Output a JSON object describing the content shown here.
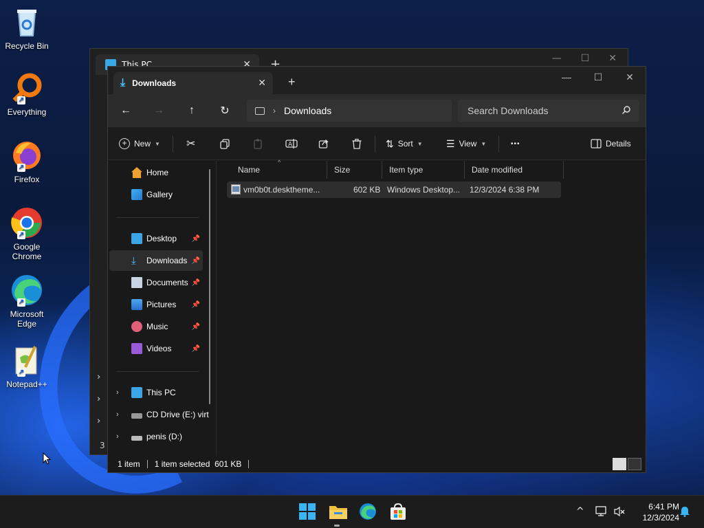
{
  "desktop": {
    "icons": [
      {
        "label": "Recycle Bin",
        "icon": "recycle-bin-icon"
      },
      {
        "label": "Everything",
        "icon": "everything-search-icon"
      },
      {
        "label": "Firefox",
        "icon": "firefox-icon"
      },
      {
        "label": "Google Chrome",
        "icon": "chrome-icon"
      },
      {
        "label": "Microsoft Edge",
        "icon": "edge-icon"
      },
      {
        "label": "Notepad++",
        "icon": "notepadpp-icon"
      }
    ]
  },
  "back_window": {
    "tab_title": "This PC",
    "new_tab": "+",
    "status_count": "3"
  },
  "window": {
    "tab_title": "Downloads",
    "tab_close": "✕",
    "new_tab": "+",
    "controls": {
      "minimize": "—",
      "maximize": "☐",
      "close": "✕"
    },
    "address": {
      "location": "Downloads",
      "separator": "›"
    },
    "search": {
      "placeholder": "Search Downloads"
    },
    "commands": {
      "new": "New",
      "sort": "Sort",
      "view": "View",
      "more": "•••",
      "details": "Details"
    },
    "sidebar": {
      "top": [
        {
          "label": "Home",
          "icon": "home-icon"
        },
        {
          "label": "Gallery",
          "icon": "gallery-icon"
        }
      ],
      "pinned": [
        {
          "label": "Desktop",
          "icon": "desktop-folder-icon",
          "selected": false
        },
        {
          "label": "Downloads",
          "icon": "downloads-folder-icon",
          "selected": true
        },
        {
          "label": "Documents",
          "icon": "documents-folder-icon",
          "selected": false
        },
        {
          "label": "Pictures",
          "icon": "pictures-folder-icon",
          "selected": false
        },
        {
          "label": "Music",
          "icon": "music-folder-icon",
          "selected": false
        },
        {
          "label": "Videos",
          "icon": "videos-folder-icon",
          "selected": false
        }
      ],
      "drives": [
        {
          "label": "This PC",
          "icon": "this-pc-icon"
        },
        {
          "label": "CD Drive (E:) virt",
          "icon": "cd-drive-icon"
        },
        {
          "label": "penis (D:)",
          "icon": "drive-icon"
        }
      ],
      "pin_glyph": "📌",
      "expand_glyph": "›"
    },
    "columns": {
      "name": "Name",
      "size": "Size",
      "type": "Item type",
      "modified": "Date modified"
    },
    "files": [
      {
        "name": "vm0b0t.desktheme...",
        "size": "602 KB",
        "type": "Windows Desktop...",
        "modified": "12/3/2024 6:38 PM"
      }
    ],
    "status": {
      "count": "1 item",
      "selection": "1 item selected  601 KB"
    }
  },
  "taskbar": {
    "clock_time": "6:41 PM",
    "clock_date": "12/3/2024",
    "tray_chevron": "^"
  },
  "colors": {
    "accent": "#4cc2ff",
    "folder_yellow": "#f0c040",
    "window_bg": "#191919"
  }
}
